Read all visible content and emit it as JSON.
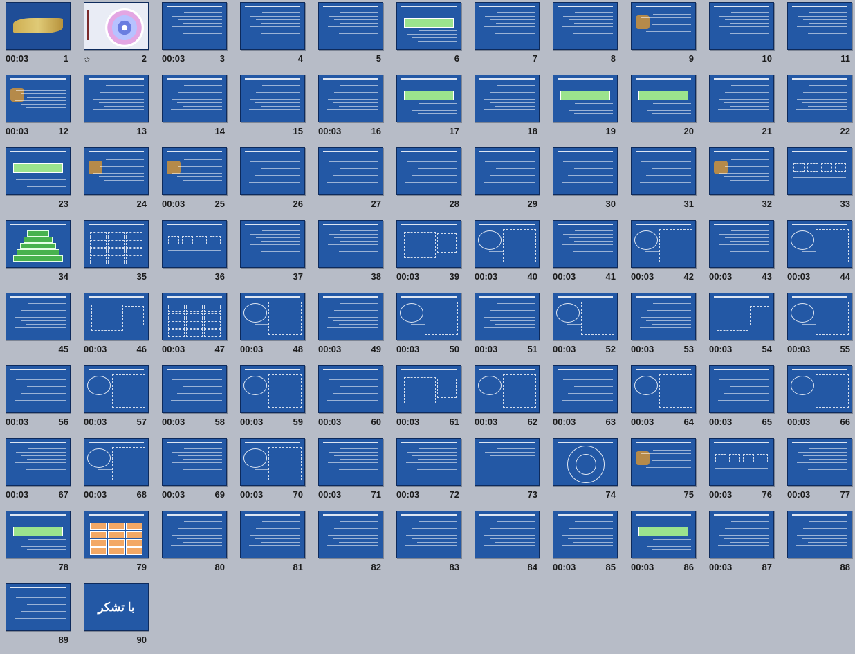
{
  "sorter": {
    "columns": 11,
    "transition_icon": "star-icon",
    "slides": [
      {
        "number": "1",
        "time": "00:03",
        "kind": "calligraphy"
      },
      {
        "number": "2",
        "time": "",
        "kind": "title-image",
        "star": true
      },
      {
        "number": "3",
        "time": "00:03",
        "kind": "text"
      },
      {
        "number": "4",
        "time": "",
        "kind": "text"
      },
      {
        "number": "5",
        "time": "",
        "kind": "text"
      },
      {
        "number": "6",
        "time": "",
        "kind": "green-box"
      },
      {
        "number": "7",
        "time": "",
        "kind": "text"
      },
      {
        "number": "8",
        "time": "",
        "kind": "text"
      },
      {
        "number": "9",
        "time": "",
        "kind": "image-text"
      },
      {
        "number": "10",
        "time": "",
        "kind": "text"
      },
      {
        "number": "11",
        "time": "",
        "kind": "text"
      },
      {
        "number": "12",
        "time": "00:03",
        "kind": "image-text"
      },
      {
        "number": "13",
        "time": "",
        "kind": "text"
      },
      {
        "number": "14",
        "time": "",
        "kind": "text"
      },
      {
        "number": "15",
        "time": "",
        "kind": "text"
      },
      {
        "number": "16",
        "time": "00:03",
        "kind": "text"
      },
      {
        "number": "17",
        "time": "",
        "kind": "green-box"
      },
      {
        "number": "18",
        "time": "",
        "kind": "text"
      },
      {
        "number": "19",
        "time": "",
        "kind": "green-box"
      },
      {
        "number": "20",
        "time": "",
        "kind": "green-box"
      },
      {
        "number": "21",
        "time": "",
        "kind": "text"
      },
      {
        "number": "22",
        "time": "",
        "kind": "text"
      },
      {
        "number": "23",
        "time": "",
        "kind": "green-box"
      },
      {
        "number": "24",
        "time": "",
        "kind": "image-text"
      },
      {
        "number": "25",
        "time": "00:03",
        "kind": "image-text"
      },
      {
        "number": "26",
        "time": "",
        "kind": "text"
      },
      {
        "number": "27",
        "time": "",
        "kind": "text"
      },
      {
        "number": "28",
        "time": "",
        "kind": "text"
      },
      {
        "number": "29",
        "time": "",
        "kind": "text"
      },
      {
        "number": "30",
        "time": "",
        "kind": "text"
      },
      {
        "number": "31",
        "time": "",
        "kind": "text"
      },
      {
        "number": "32",
        "time": "",
        "kind": "image-text"
      },
      {
        "number": "33",
        "time": "",
        "kind": "diagram"
      },
      {
        "number": "34",
        "time": "",
        "kind": "pyramid"
      },
      {
        "number": "35",
        "time": "",
        "kind": "table"
      },
      {
        "number": "36",
        "time": "",
        "kind": "diagram"
      },
      {
        "number": "37",
        "time": "",
        "kind": "text"
      },
      {
        "number": "38",
        "time": "",
        "kind": "text"
      },
      {
        "number": "39",
        "time": "00:03",
        "kind": "box"
      },
      {
        "number": "40",
        "time": "00:03",
        "kind": "oval-box"
      },
      {
        "number": "41",
        "time": "00:03",
        "kind": "text"
      },
      {
        "number": "42",
        "time": "00:03",
        "kind": "oval-box"
      },
      {
        "number": "43",
        "time": "00:03",
        "kind": "text"
      },
      {
        "number": "44",
        "time": "00:03",
        "kind": "oval-box"
      },
      {
        "number": "45",
        "time": "",
        "kind": "text"
      },
      {
        "number": "46",
        "time": "00:03",
        "kind": "box"
      },
      {
        "number": "47",
        "time": "00:03",
        "kind": "table"
      },
      {
        "number": "48",
        "time": "00:03",
        "kind": "oval-box"
      },
      {
        "number": "49",
        "time": "00:03",
        "kind": "text"
      },
      {
        "number": "50",
        "time": "00:03",
        "kind": "oval-box"
      },
      {
        "number": "51",
        "time": "00:03",
        "kind": "text"
      },
      {
        "number": "52",
        "time": "00:03",
        "kind": "oval-box"
      },
      {
        "number": "53",
        "time": "00:03",
        "kind": "text"
      },
      {
        "number": "54",
        "time": "00:03",
        "kind": "box"
      },
      {
        "number": "55",
        "time": "00:03",
        "kind": "oval-box"
      },
      {
        "number": "56",
        "time": "00:03",
        "kind": "text"
      },
      {
        "number": "57",
        "time": "00:03",
        "kind": "oval-box"
      },
      {
        "number": "58",
        "time": "00:03",
        "kind": "text"
      },
      {
        "number": "59",
        "time": "00:03",
        "kind": "oval-box"
      },
      {
        "number": "60",
        "time": "00:03",
        "kind": "text"
      },
      {
        "number": "61",
        "time": "00:03",
        "kind": "box"
      },
      {
        "number": "62",
        "time": "00:03",
        "kind": "oval-box"
      },
      {
        "number": "63",
        "time": "00:03",
        "kind": "text"
      },
      {
        "number": "64",
        "time": "00:03",
        "kind": "oval-box"
      },
      {
        "number": "65",
        "time": "00:03",
        "kind": "text"
      },
      {
        "number": "66",
        "time": "00:03",
        "kind": "oval-box"
      },
      {
        "number": "67",
        "time": "00:03",
        "kind": "text"
      },
      {
        "number": "68",
        "time": "00:03",
        "kind": "oval-box"
      },
      {
        "number": "69",
        "time": "00:03",
        "kind": "text"
      },
      {
        "number": "70",
        "time": "00:03",
        "kind": "oval-box"
      },
      {
        "number": "71",
        "time": "00:03",
        "kind": "text"
      },
      {
        "number": "72",
        "time": "00:03",
        "kind": "text"
      },
      {
        "number": "73",
        "time": "",
        "kind": "section"
      },
      {
        "number": "74",
        "time": "",
        "kind": "circle-diagram"
      },
      {
        "number": "75",
        "time": "",
        "kind": "image-text"
      },
      {
        "number": "76",
        "time": "00:03",
        "kind": "diagram"
      },
      {
        "number": "77",
        "time": "00:03",
        "kind": "text"
      },
      {
        "number": "78",
        "time": "",
        "kind": "green-box"
      },
      {
        "number": "79",
        "time": "",
        "kind": "table-orange"
      },
      {
        "number": "80",
        "time": "",
        "kind": "text"
      },
      {
        "number": "81",
        "time": "",
        "kind": "text"
      },
      {
        "number": "82",
        "time": "",
        "kind": "text"
      },
      {
        "number": "83",
        "time": "",
        "kind": "text"
      },
      {
        "number": "84",
        "time": "",
        "kind": "text"
      },
      {
        "number": "85",
        "time": "00:03",
        "kind": "text"
      },
      {
        "number": "86",
        "time": "00:03",
        "kind": "green-box"
      },
      {
        "number": "87",
        "time": "00:03",
        "kind": "text"
      },
      {
        "number": "88",
        "time": "",
        "kind": "text"
      },
      {
        "number": "89",
        "time": "",
        "kind": "text"
      },
      {
        "number": "90",
        "time": "",
        "kind": "closing",
        "text": "با تشکر"
      }
    ]
  }
}
